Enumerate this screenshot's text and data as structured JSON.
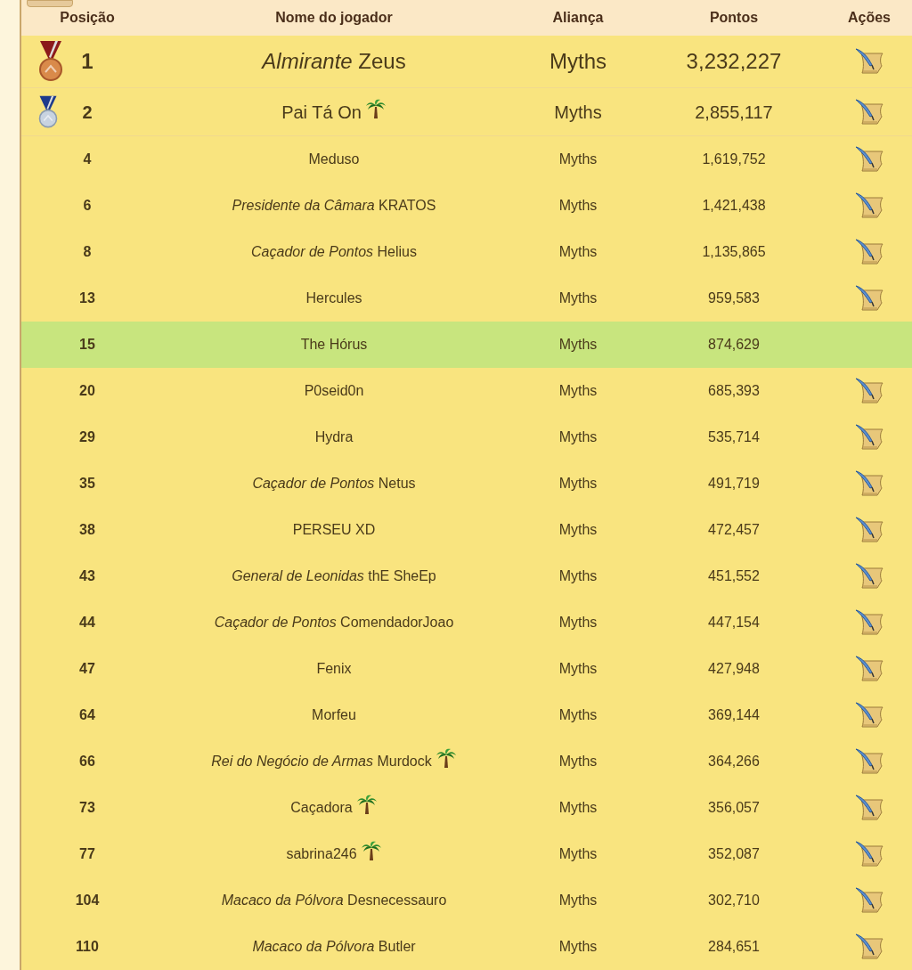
{
  "columns": [
    "Posição",
    "Nome do jogador",
    "Aliança",
    "Pontos",
    "Ações"
  ],
  "rows": [
    {
      "rank": "1",
      "kind": "first",
      "name": "*Almirante* Zeus",
      "island": false,
      "alliance": "Myths",
      "points": "3,232,227",
      "selected": false
    },
    {
      "rank": "2",
      "kind": "second",
      "name": "Pai Tá On",
      "island": true,
      "alliance": "Myths",
      "points": "2,855,117",
      "selected": false
    },
    {
      "rank": "4",
      "name": "Meduso",
      "island": false,
      "alliance": "Myths",
      "points": "1,619,752",
      "selected": false
    },
    {
      "rank": "6",
      "name": "*Presidente da Câmara* KRATOS",
      "island": false,
      "alliance": "Myths",
      "points": "1,421,438",
      "selected": false
    },
    {
      "rank": "8",
      "name": "*Caçador de Pontos* Helius",
      "island": false,
      "alliance": "Myths",
      "points": "1,135,865",
      "selected": false
    },
    {
      "rank": "13",
      "name": "Hercules",
      "island": false,
      "alliance": "Myths",
      "points": "959,583",
      "selected": false
    },
    {
      "rank": "15",
      "name": "The Hórus",
      "island": false,
      "alliance": "Myths",
      "points": "874,629",
      "selected": true
    },
    {
      "rank": "20",
      "name": "P0seid0n",
      "island": false,
      "alliance": "Myths",
      "points": "685,393",
      "selected": false
    },
    {
      "rank": "29",
      "name": "Hydra",
      "island": false,
      "alliance": "Myths",
      "points": "535,714",
      "selected": false
    },
    {
      "rank": "35",
      "name": "*Caçador de Pontos* Netus",
      "island": false,
      "alliance": "Myths",
      "points": "491,719",
      "selected": false
    },
    {
      "rank": "38",
      "name": "PERSEU XD",
      "island": false,
      "alliance": "Myths",
      "points": "472,457",
      "selected": false
    },
    {
      "rank": "43",
      "name": "*General de Leonidas* thE SheEp",
      "island": false,
      "alliance": "Myths",
      "points": "451,552",
      "selected": false
    },
    {
      "rank": "44",
      "name": "*Caçador de Pontos* ComendadorJoao",
      "island": false,
      "alliance": "Myths",
      "points": "447,154",
      "selected": false
    },
    {
      "rank": "47",
      "name": "Fenix",
      "island": false,
      "alliance": "Myths",
      "points": "427,948",
      "selected": false
    },
    {
      "rank": "64",
      "name": "Morfeu",
      "island": false,
      "alliance": "Myths",
      "points": "369,144",
      "selected": false
    },
    {
      "rank": "66",
      "name": "*Rei do Negócio de Armas* Murdock",
      "island": true,
      "alliance": "Myths",
      "points": "364,266",
      "selected": false
    },
    {
      "rank": "73",
      "name": "Caçadora",
      "island": true,
      "alliance": "Myths",
      "points": "356,057",
      "selected": false
    },
    {
      "rank": "77",
      "name": "sabrina246",
      "island": true,
      "alliance": "Myths",
      "points": "352,087",
      "selected": false
    },
    {
      "rank": "104",
      "name": "*Macaco da Pólvora* Desnecessauro",
      "island": false,
      "alliance": "Myths",
      "points": "302,710",
      "selected": false
    },
    {
      "rank": "110",
      "name": "*Macaco da Pólvora* Butler",
      "island": false,
      "alliance": "Myths",
      "points": "284,651",
      "selected": false
    }
  ]
}
